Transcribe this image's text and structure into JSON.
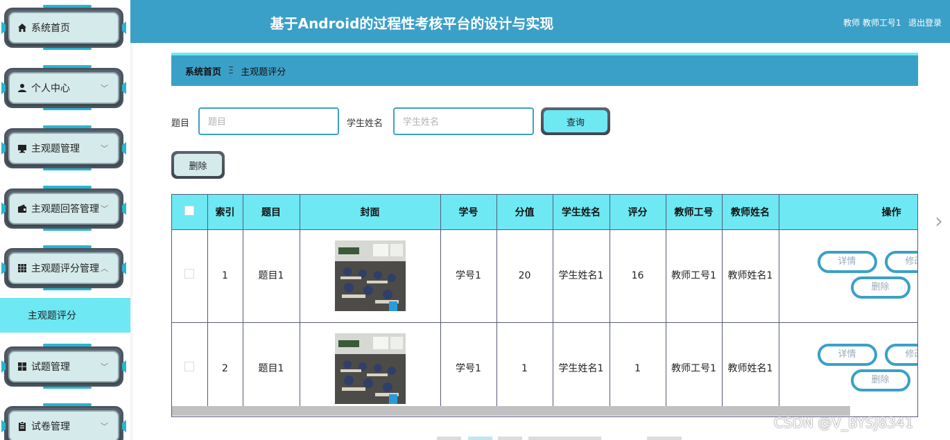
{
  "header": {
    "title": "基于Android的过程性考核平台的设计与实现",
    "user": "教师 教师工号1",
    "logout": "退出登录"
  },
  "sidebar": {
    "items": [
      {
        "label": "系统首页",
        "icon": "home-icon",
        "chevron": ""
      },
      {
        "label": "个人中心",
        "icon": "user-icon",
        "chevron": "﹀"
      },
      {
        "label": "主观题管理",
        "icon": "monitor-icon",
        "chevron": "﹀"
      },
      {
        "label": "主观题回答管理",
        "icon": "wallet-icon",
        "chevron": "﹀"
      },
      {
        "label": "主观题评分管理",
        "icon": "grid-icon",
        "chevron": "︿"
      },
      {
        "label": "试题管理",
        "icon": "apps-icon",
        "chevron": "﹀"
      },
      {
        "label": "试卷管理",
        "icon": "clipboard-icon",
        "chevron": "﹀"
      }
    ],
    "submenu": "主观题评分"
  },
  "breadcrumb": {
    "home": "系统首页",
    "separator": "Ξ",
    "current": "主观题评分"
  },
  "search": {
    "title_label": "题目",
    "title_placeholder": "题目",
    "student_label": "学生姓名",
    "student_placeholder": "学生姓名",
    "query_button": "查询"
  },
  "toolbar": {
    "delete_button": "删除"
  },
  "table": {
    "columns": [
      "索引",
      "题目",
      "封面",
      "学号",
      "分值",
      "学生姓名",
      "评分",
      "教师工号",
      "教师姓名",
      "操作"
    ],
    "rows": [
      {
        "index": "1",
        "title": "题目1",
        "student_id": "学号1",
        "score_value": "20",
        "student_name": "学生姓名1",
        "score": "16",
        "teacher_id": "教师工号1",
        "teacher_name": "教师姓名1"
      },
      {
        "index": "2",
        "title": "题目1",
        "student_id": "学号1",
        "score_value": "1",
        "student_name": "学生姓名1",
        "score": "1",
        "teacher_id": "教师工号1",
        "teacher_name": "教师姓名1"
      }
    ],
    "actions": {
      "detail": "详情",
      "edit": "修改",
      "delete": "删除"
    }
  },
  "watermark": "CSDN @V_BYSJ8341",
  "colors": {
    "primary": "#3ba0c8",
    "accent": "#6ee8f3",
    "menu_bg": "#d5eaeb"
  }
}
